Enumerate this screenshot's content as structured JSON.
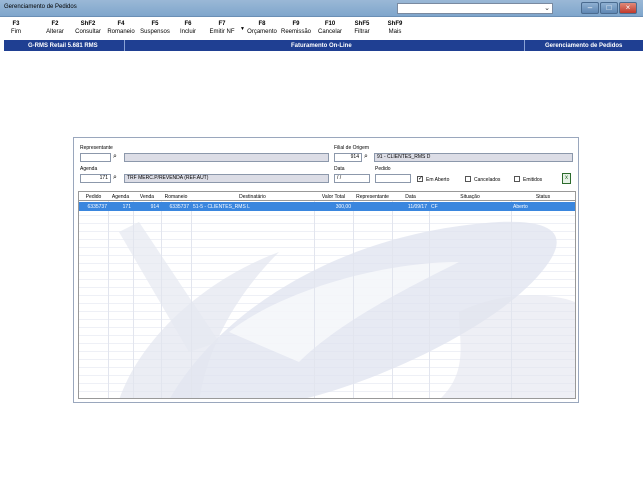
{
  "window": {
    "title": "Gerenciamento de Pedidos"
  },
  "toolbar": [
    {
      "key": "F3",
      "label": "Fim"
    },
    {
      "key": "F2",
      "label": "Alterar"
    },
    {
      "key": "ShF2",
      "label": "Consultar"
    },
    {
      "key": "F4",
      "label": "Romaneio"
    },
    {
      "key": "F5",
      "label": "Suspensos"
    },
    {
      "key": "F6",
      "label": "Incluir"
    },
    {
      "key": "F7",
      "label": "Emitir NF"
    },
    {
      "key": "F8",
      "label": "Orçamento"
    },
    {
      "key": "F9",
      "label": "Reemissão"
    },
    {
      "key": "F10",
      "label": "Cancelar"
    },
    {
      "key": "ShF5",
      "label": "Filtrar"
    },
    {
      "key": "ShF9",
      "label": "Mais"
    }
  ],
  "header": {
    "left": "G-RMS Retail 5.681 RMS",
    "center": "Faturamento On-Line",
    "right": "Gerenciamento de Pedidos"
  },
  "form": {
    "representante_label": "Representante",
    "representante_code": "",
    "representante_name": "",
    "filial_label": "Filial de Origem",
    "filial_code": "914",
    "filial_name": "91 - CLIENTES_RMS    D",
    "agenda_label": "Agenda",
    "agenda_code": "171",
    "agenda_name": "TRF MERC.P/REVENDA (REF.AUT)",
    "data_label": "Data",
    "data_value": " / /",
    "pedido_label": "Pedido",
    "pedido_value": "",
    "em_aberto_label": "Em Aberto",
    "em_aberto_checked": "✓",
    "cancelados_label": "Cancelados",
    "emitidos_label": "Emitidos"
  },
  "table": {
    "columns": [
      "Pedido",
      "Agenda",
      "Venda",
      "Romaneio",
      "Destinatário",
      "Valor Total",
      "Representante",
      "Data",
      "Situação",
      "Status"
    ],
    "rows": [
      [
        "6335737",
        "171",
        "914",
        "6335737",
        "51-5 - CLIENTES_RMS    L",
        "300,00",
        "",
        "11/09/17",
        "CF",
        "Aberto"
      ]
    ]
  }
}
